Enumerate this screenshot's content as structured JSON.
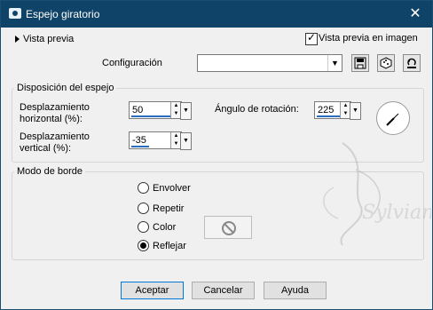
{
  "window": {
    "title": "Espejo giratorio",
    "icon": "camera-icon",
    "close_glyph": "✕"
  },
  "preview": {
    "toggle_label": "Vista previa",
    "checkbox_label": "Vista previa en imagen",
    "checked": true
  },
  "config": {
    "label": "Configuración",
    "value": ""
  },
  "mirror_group": {
    "title": "Disposición del espejo",
    "h_offset_label_1": "Desplazamiento",
    "h_offset_label_2": "horizontal (%):",
    "h_offset_value": "50",
    "v_offset_label_1": "Desplazamiento",
    "v_offset_label_2": "vertical (%):",
    "v_offset_value": "-35",
    "rotation_label": "Ángulo de rotación:",
    "rotation_value": "225"
  },
  "border_group": {
    "title": "Modo de borde",
    "options": [
      "Envolver",
      "Repetir",
      "Color",
      "Reflejar"
    ],
    "selected": "Reflejar"
  },
  "buttons": {
    "ok": "Aceptar",
    "cancel": "Cancelar",
    "help": "Ayuda"
  }
}
